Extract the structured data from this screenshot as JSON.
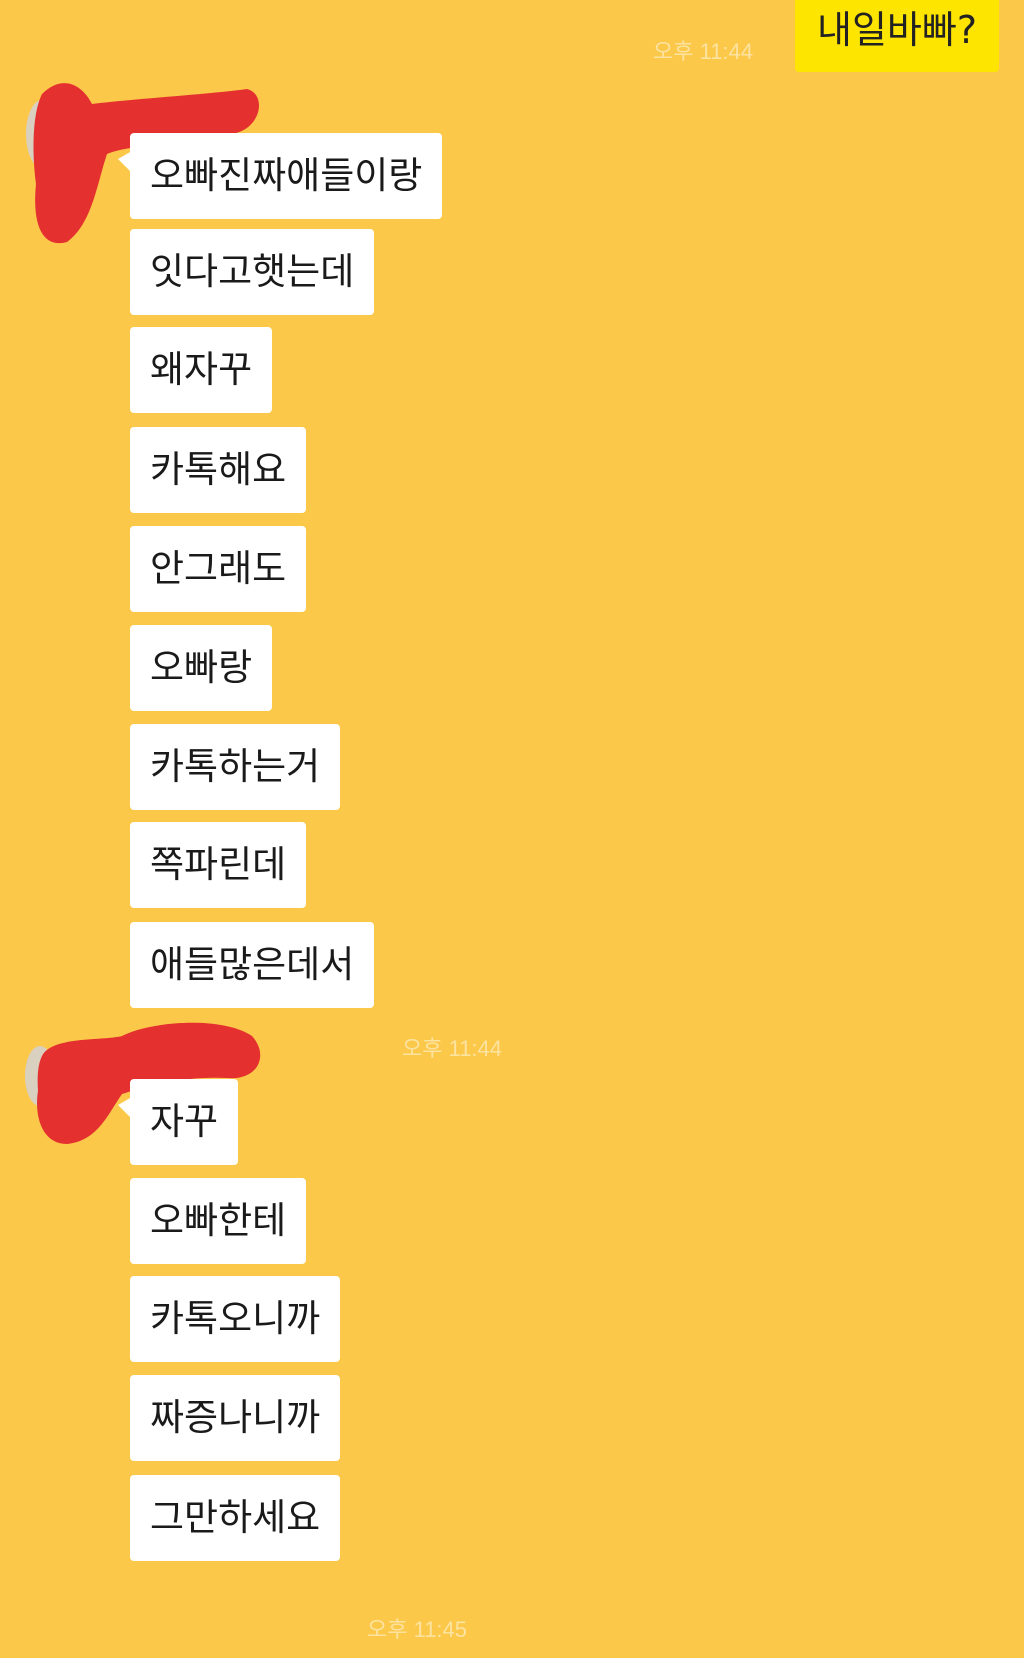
{
  "outgoing": {
    "text": "내일바빠?",
    "time": "오후 11:44"
  },
  "groups": [
    {
      "messages": [
        "오빠진짜애들이랑",
        "잇다고햇는데",
        "왜자꾸",
        "카톡해요",
        "안그래도",
        "오빠랑",
        "카톡하는거",
        "쪽파린데",
        "애들많은데서"
      ],
      "time": "오후 11:44"
    },
    {
      "messages": [
        "자꾸",
        "오빠한테",
        "카톡오니까",
        "짜증나니까",
        "그만하세요"
      ],
      "time": "오후 11:45"
    }
  ],
  "colors": {
    "background": "#fbc84a",
    "outgoing_bubble": "#fee500",
    "incoming_bubble": "#ffffff",
    "redaction": "#e53030"
  }
}
